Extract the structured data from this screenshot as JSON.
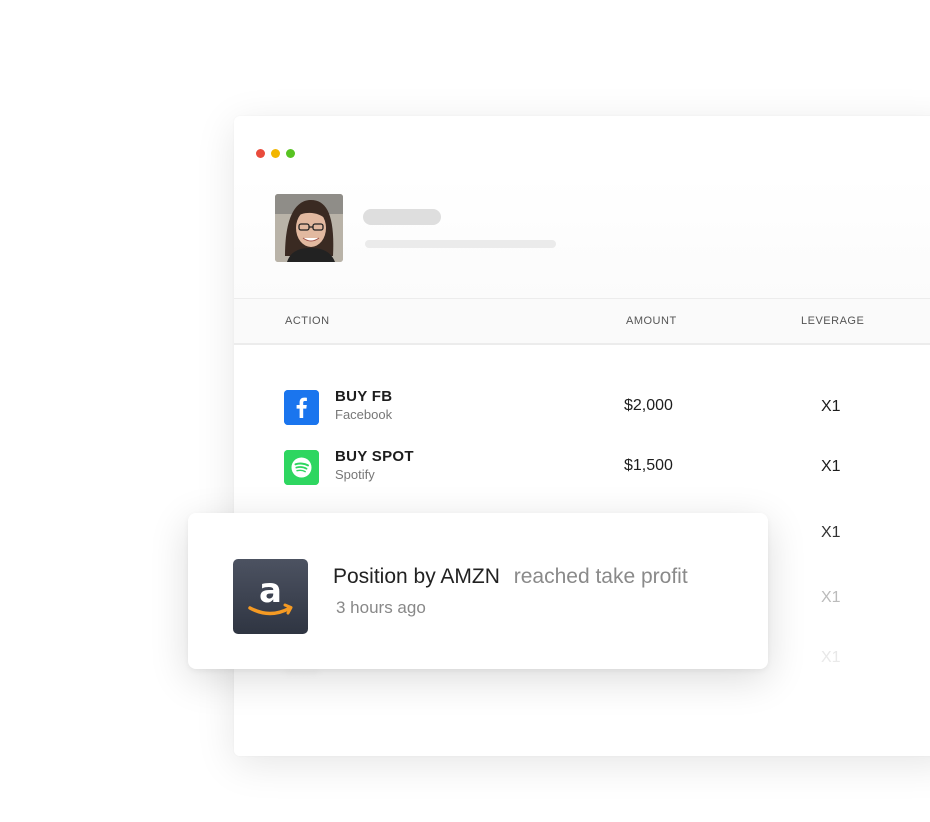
{
  "window": {
    "controls": [
      "close",
      "minimize",
      "maximize"
    ]
  },
  "table": {
    "headers": {
      "action": "ACTION",
      "amount": "AMOUNT",
      "leverage": "LEVERAGE"
    },
    "rows": [
      {
        "title": "BUY FB",
        "subtitle": "Facebook",
        "amount": "$2,000",
        "leverage": "X1",
        "icon": "facebook-icon",
        "color": "#1877f2"
      },
      {
        "title": "BUY SPOT",
        "subtitle": "Spotify",
        "amount": "$1,500",
        "leverage": "X1",
        "icon": "spotify-icon",
        "color": "#2ed660"
      },
      {
        "leverage": "X1"
      },
      {
        "leverage": "X1"
      },
      {
        "leverage": "X1"
      }
    ]
  },
  "notification": {
    "title": "Position by AMZN",
    "message": "reached take profit",
    "time": "3 hours ago",
    "icon": "amazon-icon"
  }
}
